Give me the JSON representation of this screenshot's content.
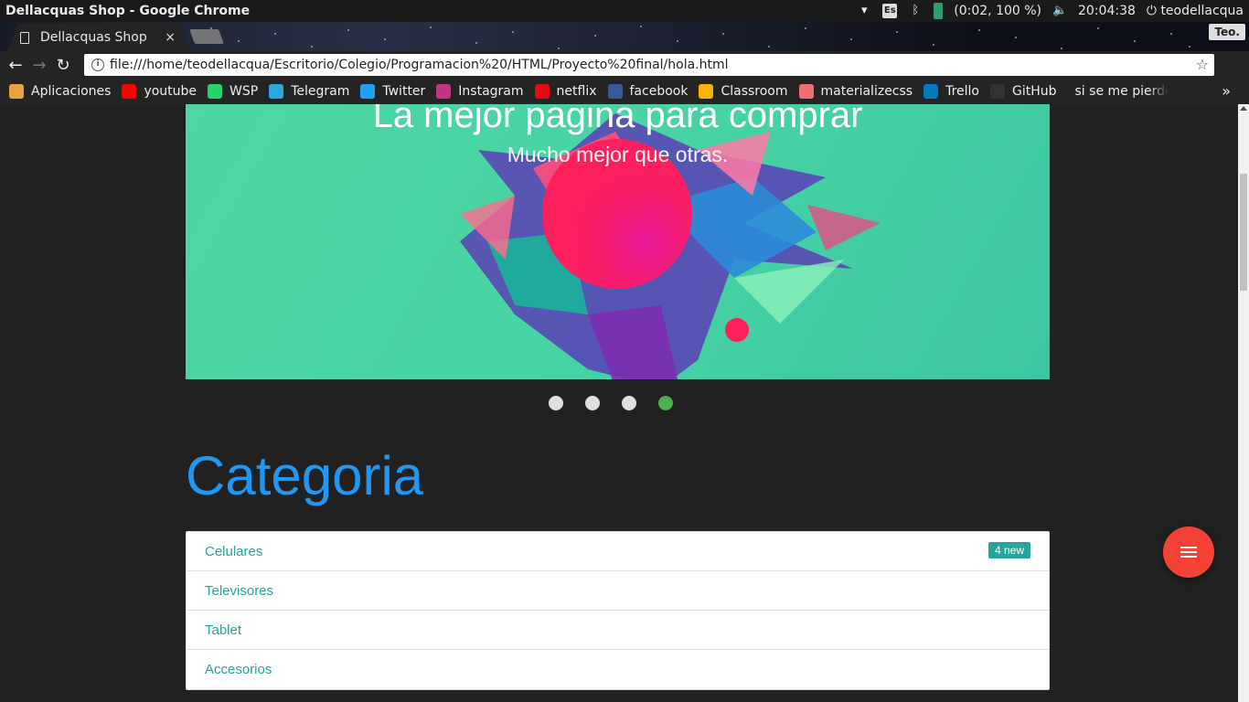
{
  "os": {
    "window_title": "Dellacquas Shop - Google Chrome",
    "keyboard_layout": "Es",
    "battery": "(0:02, 100 %)",
    "clock": "20:04:38",
    "user": "teodellacqua"
  },
  "browser": {
    "tab_title": "Dellacquas Shop",
    "tab_close": "×",
    "profile": "Teo.",
    "url": "file:///home/teodellacqua/Escritorio/Colegio/Programacion%20/HTML/Proyecto%20final/hola.html",
    "bookmarks": [
      {
        "label": "Aplicaciones",
        "color": "#e8a33d"
      },
      {
        "label": "youtube",
        "color": "#ff0000"
      },
      {
        "label": "WSP",
        "color": "#25d366"
      },
      {
        "label": "Telegram",
        "color": "#2ca5e0"
      },
      {
        "label": "Twitter",
        "color": "#1da1f2"
      },
      {
        "label": "Instagram",
        "color": "#c13584"
      },
      {
        "label": "netflix",
        "color": "#e50914"
      },
      {
        "label": "facebook",
        "color": "#3b5998"
      },
      {
        "label": "Classroom",
        "color": "#f4b400"
      },
      {
        "label": "materializecss",
        "color": "#ee6e73"
      },
      {
        "label": "Trello",
        "color": "#0079bf"
      },
      {
        "label": "GitHub",
        "color": "#333333"
      },
      {
        "label": "si se me pierde e",
        "color": "#4285f4"
      }
    ],
    "bookmarks_more": "»"
  },
  "carousel": {
    "title": "La mejor pagina para comprar",
    "subtitle": "Mucho mejor que otras.",
    "slide_count": 4,
    "active_index": 3
  },
  "category": {
    "heading": "Categoria",
    "items": [
      {
        "label": "Celulares",
        "badge": "4 new"
      },
      {
        "label": "Televisores"
      },
      {
        "label": "Tablet"
      },
      {
        "label": "Accesorios"
      }
    ]
  },
  "colors": {
    "heading": "#2196f3",
    "link": "#26a69a",
    "fab": "#f44336",
    "dot_active": "#4caf50"
  }
}
